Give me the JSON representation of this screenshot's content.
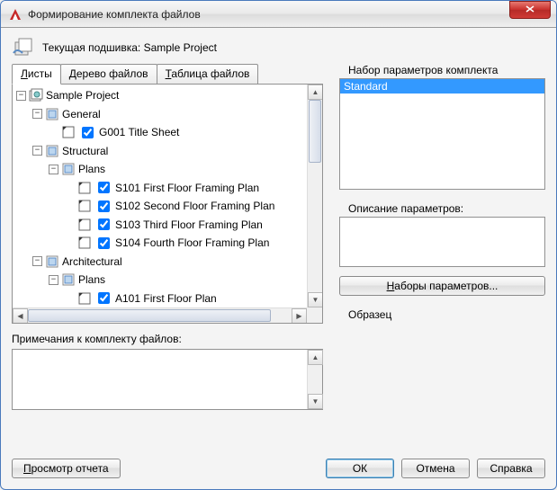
{
  "window": {
    "title": "Формирование комплекта файлов"
  },
  "header": {
    "label_prefix": "Текущая подшивка: ",
    "project_name": "Sample Project"
  },
  "tabs": {
    "sheets": "Листы",
    "file_tree": "Дерево файлов",
    "file_table": "Таблица файлов",
    "sheets_accel": "Л",
    "sheets_rest": "исты",
    "file_tree_accel": "Д",
    "file_tree_rest": "ерево файлов",
    "file_table_accel": "Т",
    "file_table_rest": "аблица файлов"
  },
  "tree": {
    "root": {
      "label": "Sample Project"
    },
    "n1": {
      "label": "General"
    },
    "n1a": {
      "label": "G001 Title Sheet",
      "checked": true
    },
    "n2": {
      "label": "Structural"
    },
    "n2a": {
      "label": "Plans"
    },
    "n2a1": {
      "label": "S101 First Floor Framing Plan",
      "checked": true
    },
    "n2a2": {
      "label": "S102 Second Floor Framing Plan",
      "checked": true
    },
    "n2a3": {
      "label": "S103 Third Floor Framing Plan",
      "checked": true
    },
    "n2a4": {
      "label": "S104 Fourth Floor Framing Plan",
      "checked": true
    },
    "n3": {
      "label": "Architectural"
    },
    "n3a": {
      "label": "Plans"
    },
    "n3a1": {
      "label": "A101 First Floor Plan",
      "checked": true
    }
  },
  "notes": {
    "label": "Примечания к комплекту файлов:",
    "value": ""
  },
  "right": {
    "setup_group": "Набор параметров комплекта",
    "setup_selected": "Standard",
    "desc_group": "Описание параметров:",
    "setups_button_pre": "Н",
    "setups_button_rest": "аборы параметров...",
    "sample_group": "Образец"
  },
  "footer": {
    "view_report_pre": "П",
    "view_report_rest": "росмотр отчета",
    "ok": "ОК",
    "cancel": "Отмена",
    "help": "Справка"
  }
}
